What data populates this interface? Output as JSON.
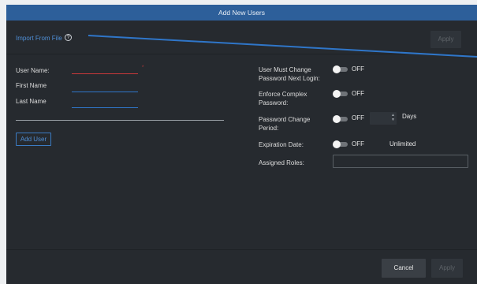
{
  "dialog": {
    "title": "Add New Users",
    "import_link": "Import From File",
    "help_icon": "?",
    "apply_top_label": "Apply"
  },
  "form": {
    "user_name_label": "User Name:",
    "first_name_label": "First Name",
    "last_name_label": "Last Name",
    "required_marker": "*",
    "add_user_label": "Add User"
  },
  "settings": {
    "must_change_label": "User Must Change Password Next Login:",
    "complex_label": "Enforce Complex Password:",
    "change_period_label": "Password Change Period:",
    "expiration_label": "Expiration Date:",
    "roles_label": "Assigned Roles:",
    "toggle_state": "OFF",
    "days_label": "Days",
    "unlimited_label": "Unlimited"
  },
  "footer": {
    "cancel_label": "Cancel",
    "apply_label": "Apply"
  },
  "colors": {
    "title_bar": "#2d5f9a",
    "panel": "#262a2f",
    "link": "#4f8fd6",
    "error": "#c9383a"
  }
}
